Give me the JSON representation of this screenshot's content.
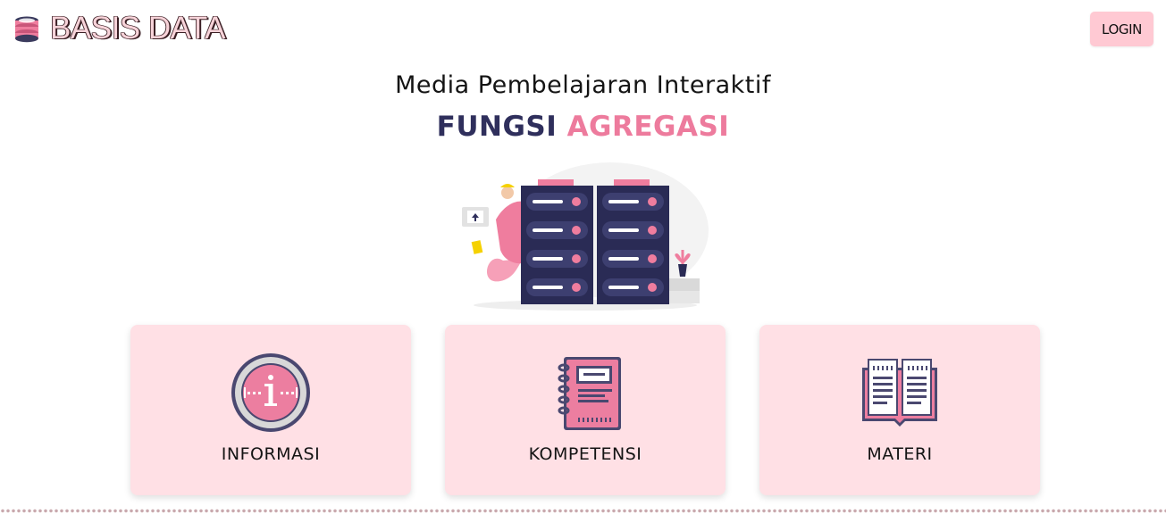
{
  "header": {
    "brand_title": "BASIS DATA",
    "brand_icon": "database-icon",
    "login_label": "LOGIN"
  },
  "hero": {
    "subtitle": "Media Pembelajaran Interaktif",
    "title_part1": "FUNGSI",
    "title_part2": "AGREGASI",
    "illustration": "server-illustration"
  },
  "cards": [
    {
      "label": "INFORMASI",
      "icon": "info-icon"
    },
    {
      "label": "KOMPETENSI",
      "icon": "notebook-icon"
    },
    {
      "label": "MATERI",
      "icon": "open-book-icon"
    }
  ],
  "colors": {
    "accent_pink": "#ed7b9d",
    "navy": "#2f2f5c",
    "card_bg": "#ffe0e5",
    "login_bg": "#ffc9d3",
    "brand_text": "#f7d3d9"
  }
}
